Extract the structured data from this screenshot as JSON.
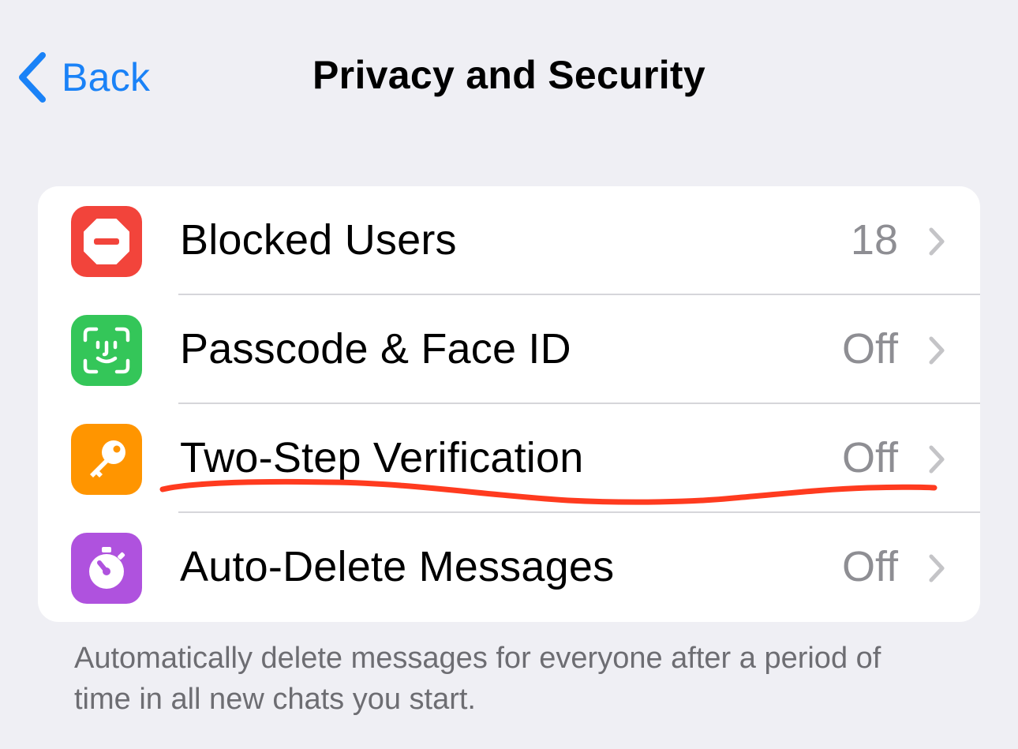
{
  "nav": {
    "back_label": "Back",
    "back_icon": "chevron-left-icon",
    "title": "Privacy and Security"
  },
  "settings": {
    "rows": [
      {
        "label": "Blocked Users",
        "value": "18",
        "icon": "blocked-icon",
        "icon_color": "#f2443b"
      },
      {
        "label": "Passcode & Face ID",
        "value": "Off",
        "icon": "face-id-icon",
        "icon_color": "#34c659"
      },
      {
        "label": "Two-Step Verification",
        "value": "Off",
        "icon": "key-icon",
        "icon_color": "#ff9500"
      },
      {
        "label": "Auto-Delete Messages",
        "value": "Off",
        "icon": "timer-icon",
        "icon_color": "#af52de"
      }
    ]
  },
  "footer": {
    "note": "Automatically delete messages for everyone after a period of time in all new chats you start."
  },
  "colors": {
    "accent": "#1a82f7",
    "background": "#efeff4",
    "annotation": "#ff3b1f"
  }
}
